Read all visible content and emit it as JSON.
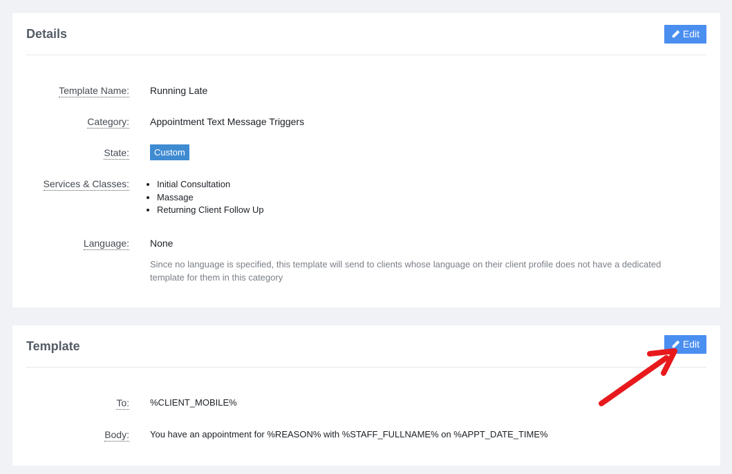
{
  "details": {
    "title": "Details",
    "edit_label": "Edit",
    "fields": {
      "template_name": {
        "label": "Template Name:",
        "value": "Running Late"
      },
      "category": {
        "label": "Category:",
        "value": "Appointment Text Message Triggers"
      },
      "state": {
        "label": "State:",
        "value": "Custom"
      },
      "services": {
        "label": "Services & Classes:",
        "items": [
          "Initial Consultation",
          "Massage",
          "Returning Client Follow Up"
        ]
      },
      "language": {
        "label": "Language:",
        "value": "None",
        "note": "Since no language is specified, this template will send to clients whose language on their client profile does not have a dedicated template for them in this category"
      }
    }
  },
  "template": {
    "title": "Template",
    "edit_label": "Edit",
    "fields": {
      "to": {
        "label": "To:",
        "value": "%CLIENT_MOBILE%"
      },
      "body": {
        "label": "Body:",
        "value": "You have an appointment for %REASON% with %STAFF_FULLNAME% on %APPT_DATE_TIME%"
      }
    }
  },
  "colors": {
    "edit_button": "#4a8ef0",
    "state_badge": "#3f8bd1",
    "annotation_arrow": "#e8191c"
  }
}
